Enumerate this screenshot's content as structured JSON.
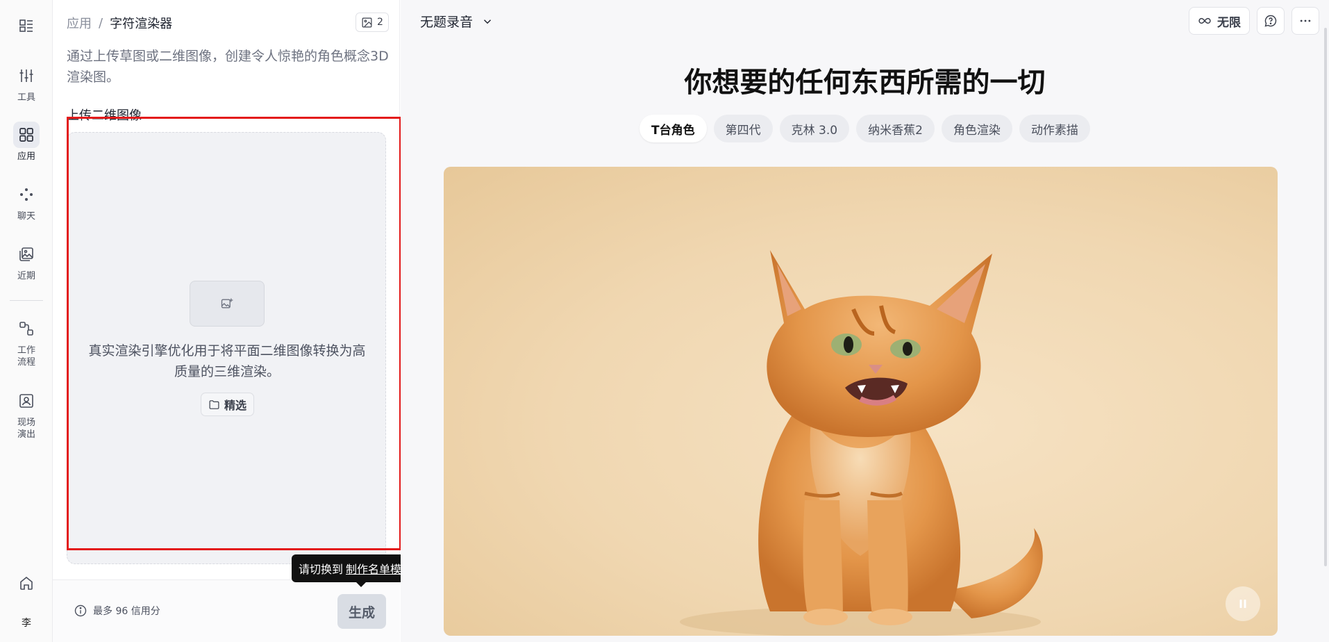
{
  "rail": {
    "items": [
      {
        "label": "工具",
        "icon": "sliders-icon"
      },
      {
        "label": "应用",
        "icon": "apps-grid-icon",
        "active": true
      },
      {
        "label": "聊天",
        "icon": "chat-dots-icon"
      },
      {
        "label": "近期",
        "icon": "recent-images-icon"
      },
      {
        "label": "工作流程",
        "icon": "workflow-icon"
      },
      {
        "label": "现场演出",
        "icon": "live-portrait-icon"
      }
    ],
    "avatar": "李"
  },
  "panel": {
    "breadcrumb": {
      "root": "应用",
      "sep": "/",
      "current": "字符渲染器"
    },
    "image_count": "2",
    "description": "通过上传草图或二维图像，创建令人惊艳的角色概念3D渲染图。",
    "upload_label": "上传二维图像",
    "drop_text": "真实渲染引擎优化用于将平面二维图像转换为高质量的三维渲染。",
    "featured_label": "精选",
    "credit_text": "最多 96 信用分",
    "generate_label": "生成",
    "tooltip": {
      "prefix": "请切换到",
      "link": "制作名单模式",
      "suffix": "."
    }
  },
  "main": {
    "doc_title": "无题录音",
    "unlimited_label": "无限",
    "headline": "你想要的任何东西所需的一切",
    "tabs": [
      {
        "label": "T台角色",
        "active": true
      },
      {
        "label": "第四代"
      },
      {
        "label": "克林 3.0"
      },
      {
        "label": "纳米香蕉2"
      },
      {
        "label": "角色渲染"
      },
      {
        "label": "动作素描"
      }
    ]
  },
  "colors": {
    "accent_highlight": "#e31b1b",
    "tooltip_bg": "#111111",
    "hero_bg": "#f0d7b1"
  }
}
